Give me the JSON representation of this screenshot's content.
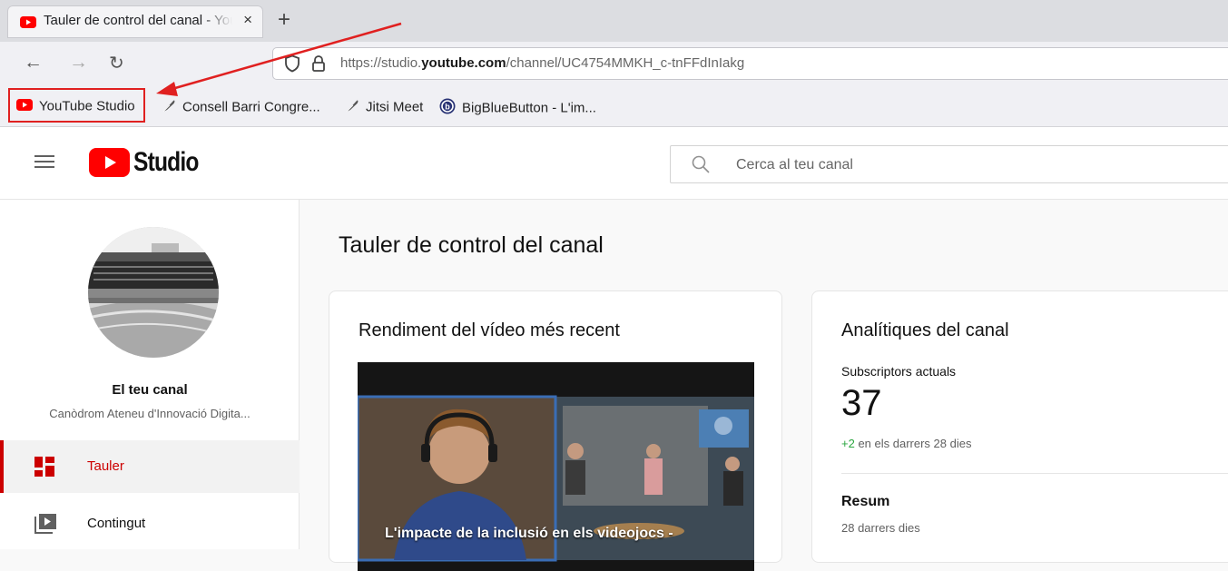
{
  "browser": {
    "tab_title": "Tauler de control del canal - YouTube Studio",
    "tab_close": "×",
    "new_tab": "+",
    "url_prefix": "https://studio.",
    "url_domain": "youtube.com",
    "url_path": "/channel/UC4754MMKH_c-tnFFdInIakg",
    "bookmarks": [
      {
        "label": "YouTube Studio",
        "icon": "youtube-icon"
      },
      {
        "label": "Consell Barri Congre...",
        "icon": "feather-icon"
      },
      {
        "label": "Jitsi Meet",
        "icon": "feather-icon"
      },
      {
        "label": "BigBlueButton - L'im...",
        "icon": "bigbluebutton-icon"
      }
    ]
  },
  "studio": {
    "logo_text": "Studio",
    "search_placeholder": "Cerca al teu canal"
  },
  "sidebar": {
    "channel_label": "El teu canal",
    "channel_name": "Canòdrom Ateneu d'Innovació Digita...",
    "items": [
      {
        "label": "Tauler",
        "icon": "dashboard-icon",
        "active": true
      },
      {
        "label": "Contingut",
        "icon": "content-icon",
        "active": false
      }
    ]
  },
  "main": {
    "page_title": "Tauler de control del canal",
    "video_card": {
      "title": "Rendiment del vídeo més recent",
      "caption": "L'impacte de la inclusió en els videojocs -"
    },
    "analytics_card": {
      "title": "Analítiques del canal",
      "subscribers_label": "Subscriptors actuals",
      "subscribers_count": "37",
      "change_value": "+2",
      "change_text": " en els darrers 28 dies",
      "summary_title": "Resum",
      "summary_period": "28 darrers dies"
    }
  },
  "colors": {
    "youtube_red": "#ff0000",
    "active_red": "#cc0000",
    "positive_green": "#2ba640",
    "annotation_red": "#e02020"
  }
}
